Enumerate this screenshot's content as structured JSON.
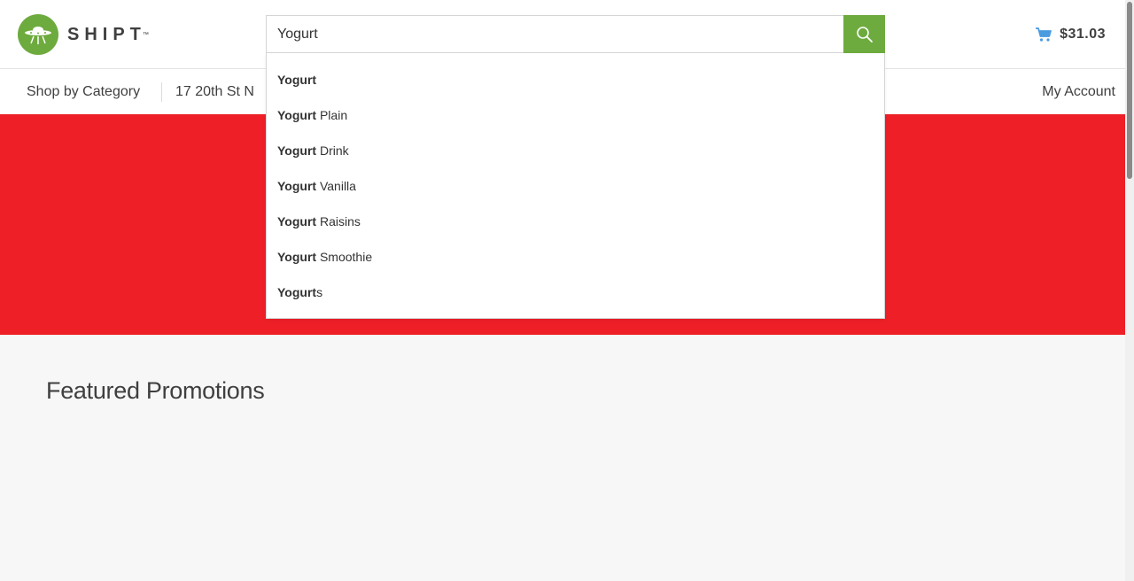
{
  "brand": {
    "name": "SHIPT",
    "trademark": "™",
    "accent_color": "#6eab3f"
  },
  "search": {
    "value": "Yogurt",
    "button_icon": "search-icon"
  },
  "cart": {
    "icon": "cart-icon",
    "total": "$31.03"
  },
  "nav": {
    "shop_by_category": "Shop by Category",
    "address": "17 20th St N",
    "my_account": "My Account"
  },
  "banner": {
    "color": "#ee1f27"
  },
  "suggestions": [
    {
      "bold": "Yogurt",
      "rest": ""
    },
    {
      "bold": "Yogurt",
      "rest": " Plain"
    },
    {
      "bold": "Yogurt",
      "rest": " Drink"
    },
    {
      "bold": "Yogurt",
      "rest": " Vanilla"
    },
    {
      "bold": "Yogurt",
      "rest": " Raisins"
    },
    {
      "bold": "Yogurt",
      "rest": " Smoothie"
    },
    {
      "bold": "Yogurt",
      "rest": "s"
    }
  ],
  "main": {
    "featured_title": "Featured Promotions"
  }
}
